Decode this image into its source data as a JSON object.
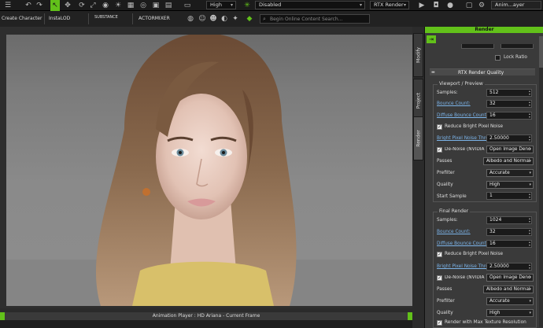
{
  "toolbar_top": {
    "quality_dropdown": "High",
    "render_mode_dropdown": "Disabled",
    "renderer_dropdown": "RTX Render",
    "player_label": "Anim...ayer"
  },
  "toolbar_second": {
    "create_character": "Create Character",
    "instalod": "InstaLOD",
    "substance": "SUBSTANCE",
    "actormixer": "ACTORMIXER",
    "search_placeholder": "Begin Online Content Search..."
  },
  "side_tabs": [
    "Modify",
    "Project",
    "Render"
  ],
  "animation_player": "Animation Player : HD Ariana - Current Frame",
  "panel": {
    "title": "Render",
    "lock_ratio": "Lock Ratio",
    "section_title": "RTX Render Quality",
    "viewport_group": {
      "title": "Viewport / Preview",
      "samples_label": "Samples:",
      "samples": "512",
      "bounce_label": "Bounce Count:",
      "bounce": "32",
      "diffuse_label": "Diffuse Bounce Count:",
      "diffuse": "16",
      "reduce_label": "Reduce Bright Pixel Noise",
      "threshold_label": "Bright Pixel Noise Threshold:",
      "threshold": "2.50000",
      "denoise_label": "De-Noise (NVIDIA O",
      "denoise": "Open Image Deno",
      "passes_label": "Passes",
      "passes": "Albedo and Normal",
      "prefilter_label": "Prefilter",
      "prefilter": "Accurate",
      "quality_label": "Quality",
      "quality": "High",
      "start_label": "Start Sample",
      "start": "1"
    },
    "final_group": {
      "title": "Final Render",
      "samples_label": "Samples:",
      "samples": "1024",
      "bounce_label": "Bounce Count:",
      "bounce": "32",
      "diffuse_label": "Diffuse Bounce Count:",
      "diffuse": "16",
      "reduce_label": "Reduce Bright Pixel Noise",
      "threshold_label": "Bright Pixel Noise Threshold:",
      "threshold": "2.50000",
      "denoise_label": "De-Noise (NVIDIA O",
      "denoise": "Open Image Deno",
      "passes_label": "Passes",
      "passes": "Albedo and Normal",
      "prefilter_label": "Prefilter",
      "prefilter": "Accurate",
      "quality_label": "Quality",
      "quality": "High",
      "max_tex_label": "Render with Max Texture Resolution"
    }
  },
  "colors": {
    "accent": "#62c11a",
    "link": "#7bb3e8"
  }
}
